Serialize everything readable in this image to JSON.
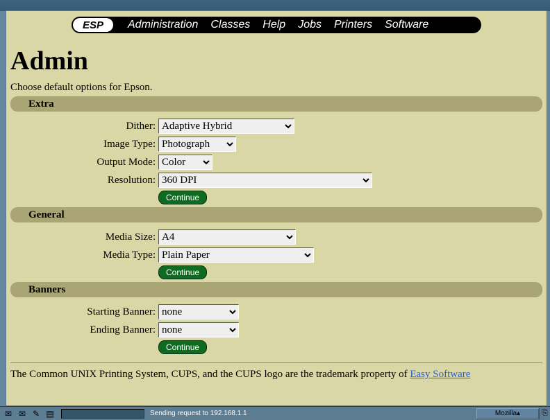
{
  "nav": {
    "logo": "ESP",
    "items": [
      "Administration",
      "Classes",
      "Help",
      "Jobs",
      "Printers",
      "Software"
    ]
  },
  "page_title": "Admin",
  "intro": "Choose default options for Epson.",
  "sections": {
    "extra": {
      "heading": "Extra",
      "dither_label": "Dither:",
      "dither_value": "Adaptive Hybrid",
      "image_type_label": "Image Type:",
      "image_type_value": "Photograph",
      "output_mode_label": "Output Mode:",
      "output_mode_value": "Color",
      "resolution_label": "Resolution:",
      "resolution_value": "360 DPI",
      "continue": "Continue"
    },
    "general": {
      "heading": "General",
      "media_size_label": "Media Size:",
      "media_size_value": "A4",
      "media_type_label": "Media Type:",
      "media_type_value": "Plain Paper",
      "continue": "Continue"
    },
    "banners": {
      "heading": "Banners",
      "start_label": "Starting Banner:",
      "start_value": "none",
      "end_label": "Ending Banner:",
      "end_value": "none",
      "continue": "Continue"
    }
  },
  "footer": {
    "text": "The Common UNIX Printing System, CUPS, and the CUPS logo are the trademark property of ",
    "link": "Easy Software"
  },
  "taskbar": {
    "status": "Sending request to 192.168.1.1",
    "button": "Mozilla"
  }
}
